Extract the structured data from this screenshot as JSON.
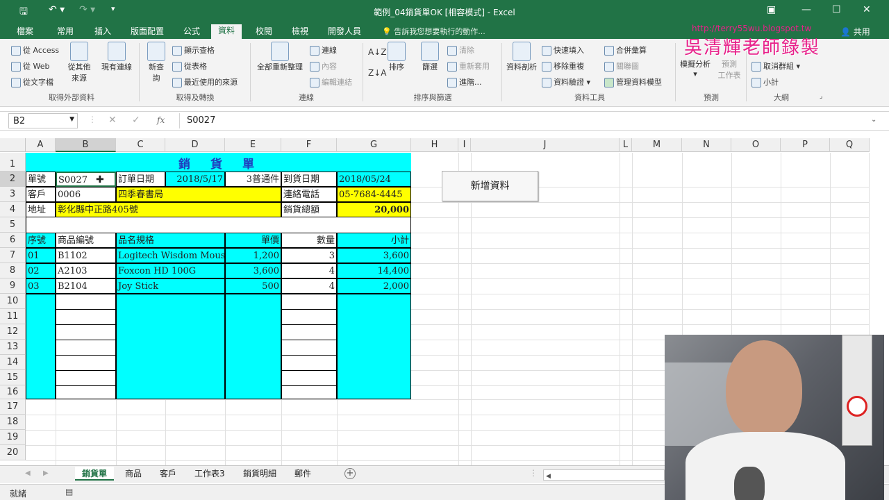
{
  "window": {
    "title": "範例_04銷貨單OK [相容模式] - Excel"
  },
  "tabs": [
    "檔案",
    "常用",
    "插入",
    "版面配置",
    "公式",
    "資料",
    "校閱",
    "檢視",
    "開發人員"
  ],
  "active_tab": "資料",
  "tellme": "告訴我您想要執行的動作...",
  "share": "共用",
  "overlay": {
    "url": "http://terry55wu.blogspot.tw",
    "author": "吳清輝老師錄製"
  },
  "ribbon": {
    "ext": {
      "access": "從 Access",
      "web": "從 Web",
      "text": "從文字檔",
      "other": "從其他",
      "other2": "來源",
      "existing": "現有連線",
      "label": "取得外部資料"
    },
    "get": {
      "newquery": "新查",
      "newquery2": "詢",
      "showquery": "顯示查格",
      "fromtable": "從表格",
      "recent": "最近使用的來源",
      "label": "取得及轉換"
    },
    "conn": {
      "refresh": "全部重新整理",
      "connections": "連線",
      "props": "內容",
      "editlinks": "編輯連結",
      "label": "連線"
    },
    "sort": {
      "sort": "排序",
      "filter": "篩選",
      "clear": "清除",
      "reapply": "重新套用",
      "advanced": "進階...",
      "label": "排序與篩選"
    },
    "tools": {
      "t2c": "資料剖析",
      "flash": "快速填入",
      "dup": "移除重複",
      "valid": "資料驗證",
      "consolidate": "合併彙算",
      "relations": "關聯圖",
      "model": "管理資料模型",
      "label": "資料工具"
    },
    "forecast": {
      "whatif": "模擬分析",
      "sheet": "預測",
      "sheet2": "工作表",
      "label": "預測"
    },
    "outline": {
      "ungroup": "取消群組",
      "subtotal": "小計",
      "label": "大綱"
    }
  },
  "namebox": "B2",
  "formula": "S0027",
  "fx": "fx",
  "columns": [
    "A",
    "B",
    "C",
    "D",
    "E",
    "F",
    "G",
    "H",
    "I",
    "J",
    "L",
    "M",
    "N",
    "O",
    "P",
    "Q"
  ],
  "rows": [
    "1",
    "2",
    "3",
    "4",
    "5",
    "6",
    "7",
    "8",
    "9",
    "10",
    "11",
    "12",
    "13",
    "14",
    "15",
    "16",
    "17",
    "18",
    "19",
    "20"
  ],
  "sheet": {
    "title": "銷　貨　單",
    "r2": {
      "a": "單號",
      "b": "S0027",
      "c": "訂單日期",
      "d": "2018/5/17",
      "e": "3普通件",
      "f": "到貨日期",
      "g": "2018/05/24"
    },
    "r3": {
      "a": "客戶",
      "b": "0006",
      "c": "四季春書局",
      "f": "連絡電話",
      "g": "05-7684-4445"
    },
    "r4": {
      "a": "地址",
      "b": "彰化縣中正路405號",
      "f": "銷貨總額",
      "g": "20,000"
    },
    "headers": {
      "a": "序號",
      "b": "商品編號",
      "c": "品名規格",
      "e": "單價",
      "f": "數量",
      "g": "小計"
    },
    "items": [
      {
        "seq": "01",
        "code": "B1102",
        "name": "Logitech Wisdom Mouse",
        "price": "1,200",
        "qty": "3",
        "sub": "3,600"
      },
      {
        "seq": "02",
        "code": "A2103",
        "name": "Foxcon HD 100G",
        "price": "3,600",
        "qty": "4",
        "sub": "14,400"
      },
      {
        "seq": "03",
        "code": "B2104",
        "name": "Joy Stick",
        "price": "500",
        "qty": "4",
        "sub": "2,000"
      }
    ]
  },
  "button": "新增資料",
  "sheet_tabs": [
    "銷貨單",
    "商品",
    "客戶",
    "工作表3",
    "銷貨明細",
    "郵件"
  ],
  "active_sheet": "銷貨單",
  "status": "就緒"
}
